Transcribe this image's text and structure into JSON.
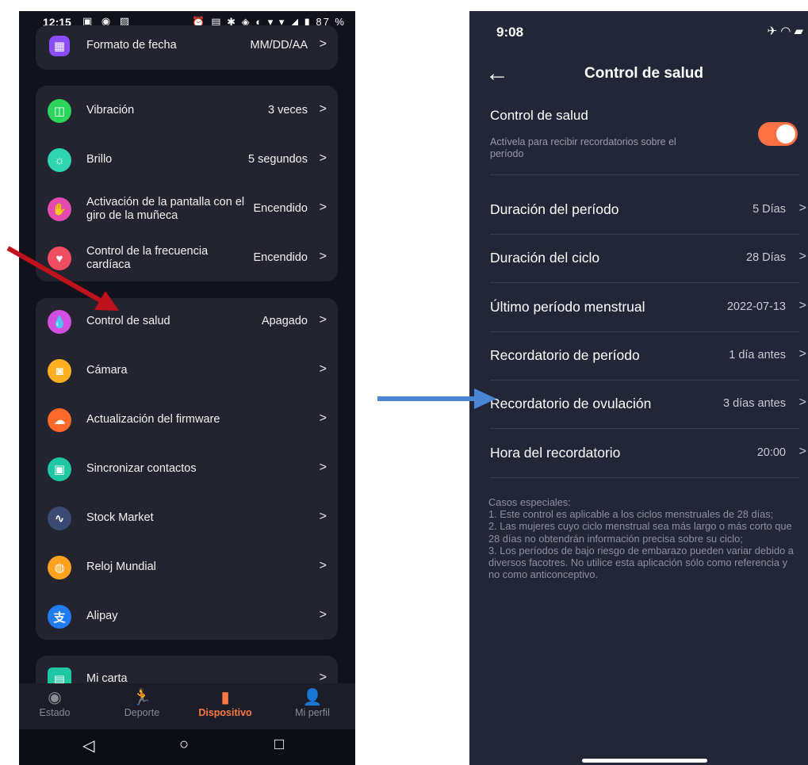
{
  "left": {
    "status_bar": {
      "time": "12:15",
      "battery": "87 %",
      "icons_left": "▣ ◉ ▨",
      "icons_right": "⏰ ▤ ✱ ◈ ◐ ▾ ▾ ◢ ▮"
    },
    "top_item": {
      "label": "Formato de fecha",
      "value": "MM/DD/AA",
      "icon": "calendar-icon",
      "color": "#8a4dff"
    },
    "group1": [
      {
        "label": "Vibración",
        "value": "3 veces",
        "icon": "vibration-icon",
        "glyph": "◫",
        "color": "#2bd45a"
      },
      {
        "label": "Brillo",
        "value": "5 segundos",
        "icon": "sun-icon",
        "glyph": "☼",
        "color": "#2fd4b0"
      },
      {
        "label": "Activación de la pantalla con el giro de la muñeca",
        "value": "Encendido",
        "icon": "wrist-icon",
        "glyph": "✋",
        "color": "#e34bb0"
      },
      {
        "label": "Control de la frecuencia cardíaca",
        "value": "Encendido",
        "icon": "heart-icon",
        "glyph": "♥",
        "color": "#f04d63"
      }
    ],
    "group2": [
      {
        "label": "Control de salud",
        "value": "Apagado",
        "icon": "drop-icon",
        "glyph": "💧",
        "color": "#d24fe0"
      },
      {
        "label": "Cámara",
        "value": "",
        "icon": "camera-icon",
        "glyph": "◙",
        "color": "#ffb020"
      },
      {
        "label": "Actualización del firmware",
        "value": "",
        "icon": "cloud-upload-icon",
        "glyph": "☁",
        "color": "#ff6a2a"
      },
      {
        "label": "Sincronizar contactos",
        "value": "",
        "icon": "contacts-icon",
        "glyph": "▣",
        "color": "#1fc7a3"
      },
      {
        "label": "Stock Market",
        "value": "",
        "icon": "stock-chart-icon",
        "glyph": "∿",
        "color": "#3b4a72"
      },
      {
        "label": "Reloj Mundial",
        "value": "",
        "icon": "globe-icon",
        "glyph": "◍",
        "color": "#ffa21f"
      },
      {
        "label": "Alipay",
        "value": "",
        "icon": "alipay-icon",
        "glyph": "支",
        "color": "#1f7cf2"
      }
    ],
    "partial_item": {
      "label": "Mi carta",
      "icon": "card-icon",
      "color": "#1fc7a3"
    },
    "chevron": ">",
    "bottom_nav": [
      {
        "label": "Estado",
        "icon": "status-icon",
        "glyph": "◉",
        "active": false
      },
      {
        "label": "Deporte",
        "icon": "running-icon",
        "glyph": "🏃",
        "active": false
      },
      {
        "label": "Dispositivo",
        "icon": "watch-icon",
        "glyph": "▮",
        "active": true
      },
      {
        "label": "Mi perfil",
        "icon": "person-icon",
        "glyph": "👤",
        "active": false
      }
    ],
    "sys_nav": {
      "back": "◁",
      "home": "○",
      "recents": "□"
    }
  },
  "right": {
    "status_bar": {
      "time": "9:08",
      "icons": "✈ ◠ ▰"
    },
    "header": {
      "back": "←",
      "title": "Control de salud"
    },
    "toggle": {
      "title": "Control de salud",
      "subtitle": "Actívela para recibir recordatorios sobre el período",
      "on": true
    },
    "rows": [
      {
        "label": "Duración del período",
        "value": "5 Días"
      },
      {
        "label": "Duración del ciclo",
        "value": "28 Días"
      },
      {
        "label": "Último período menstrual",
        "value": "2022-07-13"
      },
      {
        "label": "Recordatorio de período",
        "value": "1 día antes"
      },
      {
        "label": "Recordatorio de ovulación",
        "value": "3 días antes"
      },
      {
        "label": "Hora del recordatorio",
        "value": "20:00"
      }
    ],
    "chevron": ">",
    "notes": "Casos especiales:\n1. Este control es aplicable a los ciclos menstruales de 28 días;\n2. Las mujeres cuyo ciclo menstrual sea más largo o más corto que 28 días no obtendrán información precisa sobre su ciclo;\n3. Los períodos de bajo riesgo de embarazo pueden variar debido a diversos facotres. No utilice esta aplicación sólo como referencia y no como anticonceptivo."
  },
  "colors": {
    "red_arrow": "#c0121c",
    "blue_arrow": "#4a86d4",
    "accent": "#ff7a45"
  }
}
